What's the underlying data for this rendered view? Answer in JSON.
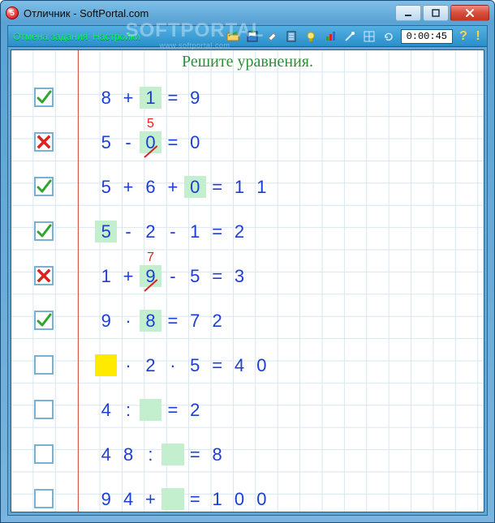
{
  "window": {
    "title": "Отличник - SoftPortal.com",
    "icon_glyph": "5"
  },
  "watermark": {
    "main": "SOFTPORTAL",
    "sub": "www.softportal.com"
  },
  "toolbar": {
    "cancel_label": "Отмена задания",
    "settings_label": "Настройки",
    "timer": "0:00:45"
  },
  "sheet": {
    "heading": "Решите уравнения.",
    "rows": [
      {
        "status": "correct",
        "cells": [
          {
            "t": "8"
          },
          {
            "t": "+"
          },
          {
            "t": "1",
            "hl": "green"
          },
          {
            "t": "="
          },
          {
            "t": "9"
          }
        ]
      },
      {
        "status": "wrong",
        "cells": [
          {
            "t": "5"
          },
          {
            "t": "-"
          },
          {
            "t": "0",
            "hl": "green",
            "strike": true,
            "correction": "5"
          },
          {
            "t": "="
          },
          {
            "t": "0"
          }
        ]
      },
      {
        "status": "correct",
        "cells": [
          {
            "t": "5"
          },
          {
            "t": "+"
          },
          {
            "t": "6"
          },
          {
            "t": "+"
          },
          {
            "t": "0",
            "hl": "green"
          },
          {
            "t": "="
          },
          {
            "t": "1"
          },
          {
            "t": "1"
          }
        ]
      },
      {
        "status": "correct",
        "cells": [
          {
            "t": "5",
            "hl": "green"
          },
          {
            "t": "-"
          },
          {
            "t": "2"
          },
          {
            "t": "-"
          },
          {
            "t": "1"
          },
          {
            "t": "="
          },
          {
            "t": "2"
          }
        ]
      },
      {
        "status": "wrong",
        "cells": [
          {
            "t": "1"
          },
          {
            "t": "+"
          },
          {
            "t": "9",
            "hl": "green",
            "strike": true,
            "correction": "7"
          },
          {
            "t": "-"
          },
          {
            "t": "5"
          },
          {
            "t": "="
          },
          {
            "t": "3"
          }
        ]
      },
      {
        "status": "correct",
        "cells": [
          {
            "t": "9"
          },
          {
            "t": "·"
          },
          {
            "t": "8",
            "hl": "green"
          },
          {
            "t": "="
          },
          {
            "t": "7"
          },
          {
            "t": "2"
          }
        ]
      },
      {
        "status": "empty",
        "cells": [
          {
            "t": "",
            "hl": "yellow"
          },
          {
            "t": "·"
          },
          {
            "t": "2"
          },
          {
            "t": "·"
          },
          {
            "t": "5"
          },
          {
            "t": "="
          },
          {
            "t": "4"
          },
          {
            "t": "0"
          }
        ]
      },
      {
        "status": "empty",
        "cells": [
          {
            "t": "4"
          },
          {
            "t": ":"
          },
          {
            "t": "",
            "hl": "green"
          },
          {
            "t": "="
          },
          {
            "t": "2"
          }
        ]
      },
      {
        "status": "empty",
        "cells": [
          {
            "t": "4"
          },
          {
            "t": "8"
          },
          {
            "t": ":"
          },
          {
            "t": "",
            "hl": "green"
          },
          {
            "t": "="
          },
          {
            "t": "8"
          }
        ]
      },
      {
        "status": "empty",
        "cells": [
          {
            "t": "9"
          },
          {
            "t": "4"
          },
          {
            "t": "+"
          },
          {
            "t": "",
            "hl": "green"
          },
          {
            "t": "="
          },
          {
            "t": "1"
          },
          {
            "t": "0"
          },
          {
            "t": "0"
          }
        ]
      }
    ]
  }
}
